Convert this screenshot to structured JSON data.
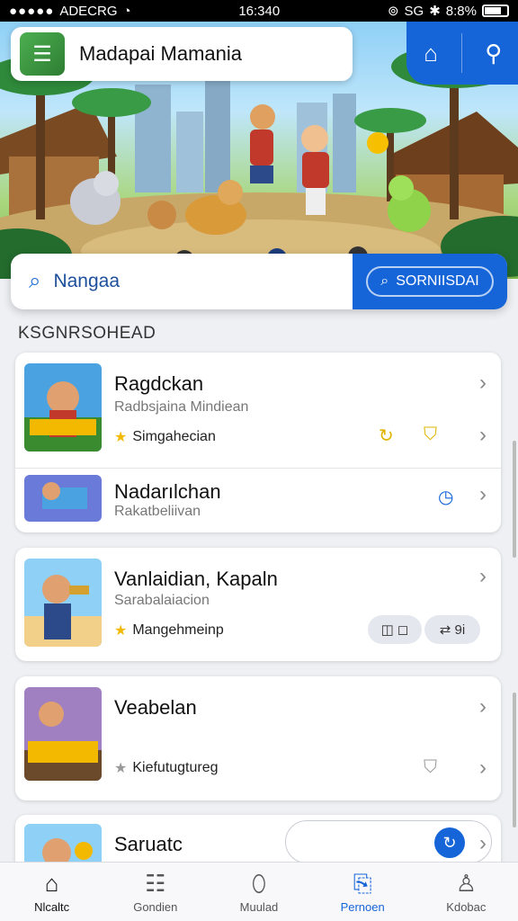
{
  "status_bar": {
    "carrier": "ADECRG",
    "time": "16:340",
    "network": "SG",
    "battery": "8:8%"
  },
  "header": {
    "app_title": "Madapai Mamania",
    "icons": [
      "home-outline-icon",
      "map-pin-icon"
    ]
  },
  "search": {
    "value": "Nangaa",
    "button_label": "SORNIISDAI"
  },
  "section_label": "KSGNRSOHEAD",
  "items": [
    {
      "title": "Ragdckan",
      "subtitle": "Radbsjaina Mindiean",
      "tag": "Simgahecian"
    },
    {
      "title": "Nadarılchan",
      "subtitle": "Rakatbeliivan"
    },
    {
      "title": "Vanlaidian, Kapaln",
      "subtitle": "Sarabalaiacion",
      "tag": "Mangehmeinp",
      "pills": [
        "◫ ◻",
        "⇄ 9i"
      ]
    },
    {
      "title": "Veabelan",
      "tag": "Kiefutugtureg"
    },
    {
      "title": "Saruatc"
    }
  ],
  "nav": [
    {
      "label": "Nlcaltc",
      "icon": "home-icon"
    },
    {
      "label": "Gondien",
      "icon": "list-icon"
    },
    {
      "label": "Muulad",
      "icon": "capsule-icon"
    },
    {
      "label": "Pernoen",
      "icon": "clipboard-icon"
    },
    {
      "label": "Kdobac",
      "icon": "person-icon"
    }
  ],
  "colors": {
    "accent": "#1565d8",
    "star": "#f2b900"
  }
}
